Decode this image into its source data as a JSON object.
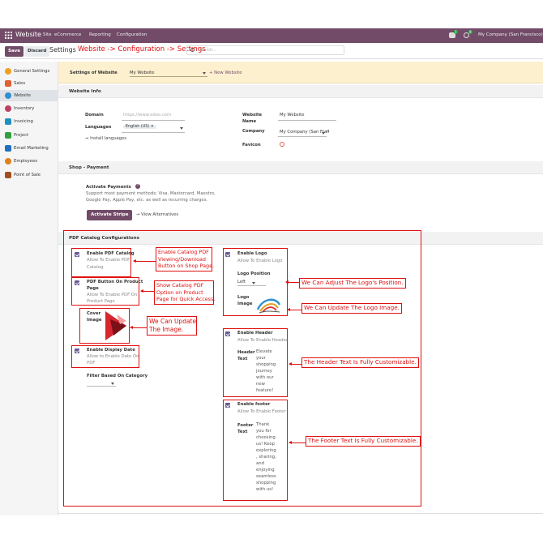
{
  "topbar": {
    "app_name": "Website",
    "menus": [
      "Site",
      "eCommerce",
      "Reporting",
      "Configuration"
    ],
    "chat_badge": "7",
    "activity_badge": "9",
    "company": "My Company (San Francisco)"
  },
  "actions": {
    "save": "Save",
    "discard": "Discard",
    "breadcrumb_settings": "Settings",
    "path_annotation": "Website -> Configuration -> Settings",
    "search_placeholder": "Search..."
  },
  "sidebar": {
    "items": [
      {
        "label": "General Settings",
        "color": "#f0a020"
      },
      {
        "label": "Sales",
        "color": "#e06030"
      },
      {
        "label": "Website",
        "color": "#3090d0"
      },
      {
        "label": "Inventory",
        "color": "#c04060"
      },
      {
        "label": "Invoicing",
        "color": "#2090c0"
      },
      {
        "label": "Project",
        "color": "#30a040"
      },
      {
        "label": "Email Marketing",
        "color": "#2070c0"
      },
      {
        "label": "Employees",
        "color": "#e08020"
      },
      {
        "label": "Point of Sale",
        "color": "#a05020"
      }
    ]
  },
  "website_bar": {
    "label": "Settings of Website",
    "selected": "My Website",
    "new_link": "+ New Website"
  },
  "website_info": {
    "title": "Website Info",
    "domain_label": "Domain",
    "domain_placeholder": "https://www.odoo.com",
    "languages_label": "Languages",
    "language_tag": "English (US)",
    "install_link": "→ Install languages",
    "website_name_label_1": "Website",
    "website_name_label_2": "Name",
    "website_name_value": "My Website",
    "company_label": "Company",
    "company_value": "My Company (San Fran",
    "favicon_label": "Favicon"
  },
  "shop_payment": {
    "title": "Shop - Payment",
    "activate_label": "Activate Payments",
    "desc_1": "Support most payment methods; Visa, Mastercard, Maestro,",
    "desc_2": "Google Pay, Apple Pay, etc. as well as recurring charges.",
    "activate_stripe": "Activate Stripe",
    "view_alternatives": "→ View Alternatives"
  },
  "pdf": {
    "title": "PDF Catalog Configurations",
    "enable_catalog": "Enable PDF Catalog",
    "enable_catalog_desc_1": "Allow To Enable PDF",
    "enable_catalog_desc_2": "Catalog",
    "pdf_button_1": "PDF Button On Product",
    "pdf_button_2": "Page",
    "pdf_button_desc_1": "Allow To Enable PDF On",
    "pdf_button_desc_2": "Product Page",
    "cover_label_1": "Cover",
    "cover_label_2": "Image",
    "enable_date": "Enable Display Date",
    "enable_date_desc_1": "Allow to Enable Date On",
    "enable_date_desc_2": "PDF",
    "filter_label": "Filter Based On Category",
    "enable_logo": "Enable Logo",
    "enable_logo_desc": "Allow To Enable Logo",
    "logo_position_label": "Logo Position",
    "logo_position_value": "Left",
    "logo_label_1": "Logo",
    "logo_label_2": "Image",
    "enable_header": "Enable Header",
    "enable_header_desc": "Allow To Enable Header",
    "header_text_label_1": "Header",
    "header_text_label_2": "Text",
    "header_text": [
      "Elevate",
      "your",
      "shopping",
      "journey",
      "with our",
      "new",
      "feature!"
    ],
    "enable_footer": "Enable footer",
    "enable_footer_desc": "Allow To Enable Footer",
    "footer_text_label_1": "Footer",
    "footer_text_label_2": "Text",
    "footer_text": [
      "Thank",
      "you for",
      "choosing",
      "us! Keep",
      "exploring",
      ", sharing,",
      "and",
      "enjoying",
      "seamless",
      "shopping",
      "with us!"
    ]
  },
  "annotations": {
    "catalog": [
      "Enable Catalog PDF",
      "Viewing/Download",
      "Button on Shop Page."
    ],
    "pdf_button": [
      "Show Catalog PDF",
      "Option on Product",
      "Page for Quick Access."
    ],
    "cover": [
      "We Can Update",
      "The Image."
    ],
    "logo_position": "We Can Adjust The Logo's Position.",
    "logo_image": "We Can Update The Logo Image.",
    "header": "The Header Text Is Fully Customizable.",
    "footer": "The Footer Text Is Fully Customizable."
  },
  "colors": {
    "topbar": "#714b67",
    "primary": "#714b67",
    "annotation": "#e01010",
    "accent_green": "#28a745"
  }
}
